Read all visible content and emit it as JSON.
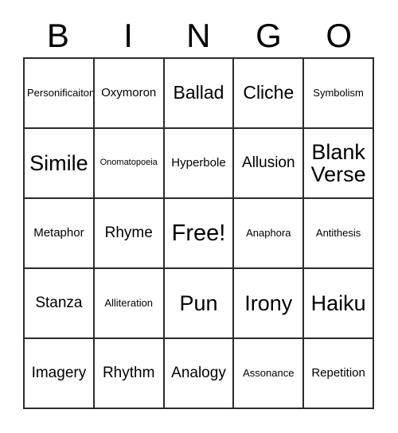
{
  "header": {
    "letters": [
      "B",
      "I",
      "N",
      "G",
      "O"
    ]
  },
  "grid": {
    "rows": [
      [
        {
          "label": "Personificaiton",
          "size": "fs-sm"
        },
        {
          "label": "Oxymoron",
          "size": "fs-md"
        },
        {
          "label": "Ballad",
          "size": "fs-xl"
        },
        {
          "label": "Cliche",
          "size": "fs-xl"
        },
        {
          "label": "Symbolism",
          "size": "fs-sm"
        }
      ],
      [
        {
          "label": "Simile",
          "size": "fs-xxl"
        },
        {
          "label": "Onomatopoeia",
          "size": "fs-xs"
        },
        {
          "label": "Hyperbole",
          "size": "fs-md"
        },
        {
          "label": "Allusion",
          "size": "fs-lg"
        },
        {
          "label": "Blank Verse",
          "size": "fs-xxl"
        }
      ],
      [
        {
          "label": "Metaphor",
          "size": "fs-md"
        },
        {
          "label": "Rhyme",
          "size": "fs-lg"
        },
        {
          "label": "Free!",
          "size": "fs-free"
        },
        {
          "label": "Anaphora",
          "size": "fs-sm"
        },
        {
          "label": "Antithesis",
          "size": "fs-sm"
        }
      ],
      [
        {
          "label": "Stanza",
          "size": "fs-lg"
        },
        {
          "label": "Alliteration",
          "size": "fs-sm"
        },
        {
          "label": "Pun",
          "size": "fs-xxl"
        },
        {
          "label": "Irony",
          "size": "fs-xxl"
        },
        {
          "label": "Haiku",
          "size": "fs-xxl"
        }
      ],
      [
        {
          "label": "Imagery",
          "size": "fs-lg"
        },
        {
          "label": "Rhythm",
          "size": "fs-lg"
        },
        {
          "label": "Analogy",
          "size": "fs-lg"
        },
        {
          "label": "Assonance",
          "size": "fs-sm"
        },
        {
          "label": "Repetition",
          "size": "fs-md"
        }
      ]
    ]
  },
  "colors": {
    "border": "#2b2b2b",
    "text": "#000000",
    "background": "#ffffff"
  }
}
